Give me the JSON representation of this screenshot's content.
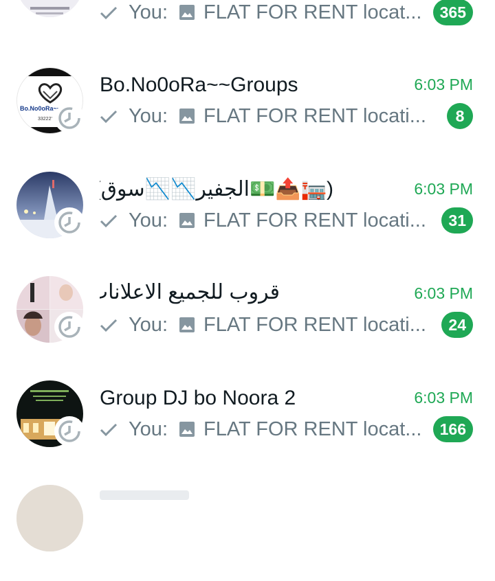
{
  "chats": [
    {
      "title": "",
      "time": "",
      "sender": "You:",
      "preview_icon": "image-icon",
      "preview": "FLAT FOR RENT locat...",
      "unread": "365",
      "status_icon": "sent-check-icon"
    },
    {
      "title": "Bo.No0oRa~~Groups",
      "time": "6:03 PM",
      "sender": "You:",
      "preview_icon": "image-icon",
      "preview": "FLAT FOR RENT locati...",
      "unread": "8",
      "status_icon": "sent-check-icon",
      "avatar_text": "Bo.No0oRa~~",
      "avatar_subtext": "33222'"
    },
    {
      "title": "(🏣📤💵الجفير📉📉سوق)",
      "time": "6:03 PM",
      "sender": "You:",
      "preview_icon": "image-icon",
      "preview": "FLAT FOR RENT locati...",
      "unread": "31",
      "status_icon": "sent-check-icon"
    },
    {
      "title": "قروب للجميع الاعلانات",
      "time": "6:03 PM",
      "sender": "You:",
      "preview_icon": "image-icon",
      "preview": "FLAT FOR RENT locati...",
      "unread": "24",
      "status_icon": "sent-check-icon"
    },
    {
      "title": "Group DJ bo Noora 2",
      "time": "6:03 PM",
      "sender": "You:",
      "preview_icon": "image-icon",
      "preview": "FLAT FOR RENT locat...",
      "unread": "166",
      "status_icon": "sent-check-icon"
    }
  ],
  "colors": {
    "accent": "#1fa855",
    "title": "#111b21",
    "secondary": "#667781"
  }
}
